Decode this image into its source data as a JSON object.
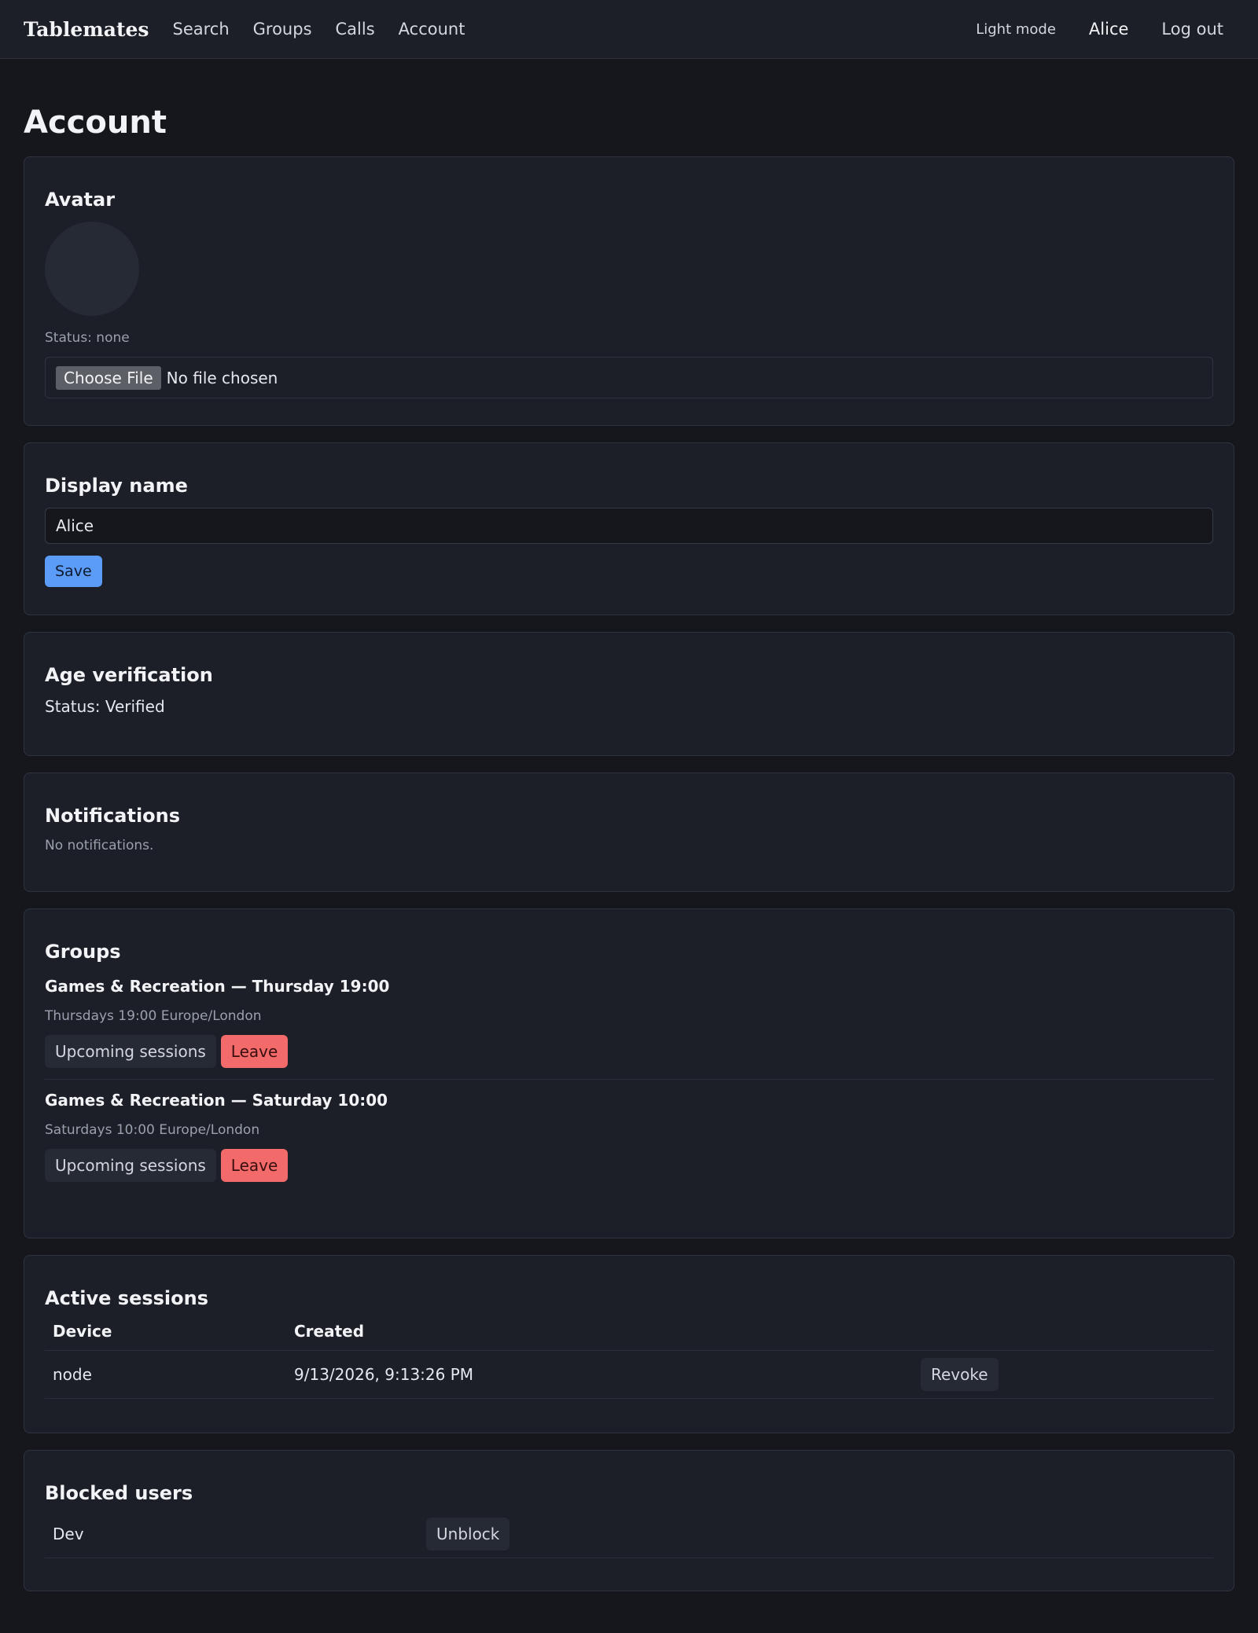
{
  "nav": {
    "brand": "Tablemates",
    "links": [
      "Search",
      "Groups",
      "Calls",
      "Account"
    ],
    "theme_toggle": "Light mode",
    "user": "Alice",
    "logout": "Log out"
  },
  "page": {
    "title": "Account"
  },
  "avatar": {
    "heading": "Avatar",
    "status": "Status: none",
    "file_button": "Choose File",
    "file_status": "No file chosen"
  },
  "display_name": {
    "heading": "Display name",
    "value": "Alice",
    "save_label": "Save"
  },
  "age_verification": {
    "heading": "Age verification",
    "status": "Status: Verified"
  },
  "notifications": {
    "heading": "Notifications",
    "empty_text": "No notifications."
  },
  "groups": {
    "heading": "Groups",
    "items": [
      {
        "title": "Games & Recreation — Thursday 19:00",
        "schedule": "Thursdays 19:00 Europe/London",
        "sessions_label": "Upcoming sessions",
        "leave_label": "Leave"
      },
      {
        "title": "Games & Recreation — Saturday 10:00",
        "schedule": "Saturdays 10:00 Europe/London",
        "sessions_label": "Upcoming sessions",
        "leave_label": "Leave"
      }
    ]
  },
  "active_sessions": {
    "heading": "Active sessions",
    "columns": [
      "Device",
      "Created",
      ""
    ],
    "rows": [
      {
        "device": "node",
        "created": "9/13/2026, 9:13:26 PM",
        "action": "Revoke"
      }
    ]
  },
  "blocked_users": {
    "heading": "Blocked users",
    "rows": [
      {
        "name": "Dev",
        "action": "Unblock"
      }
    ]
  }
}
